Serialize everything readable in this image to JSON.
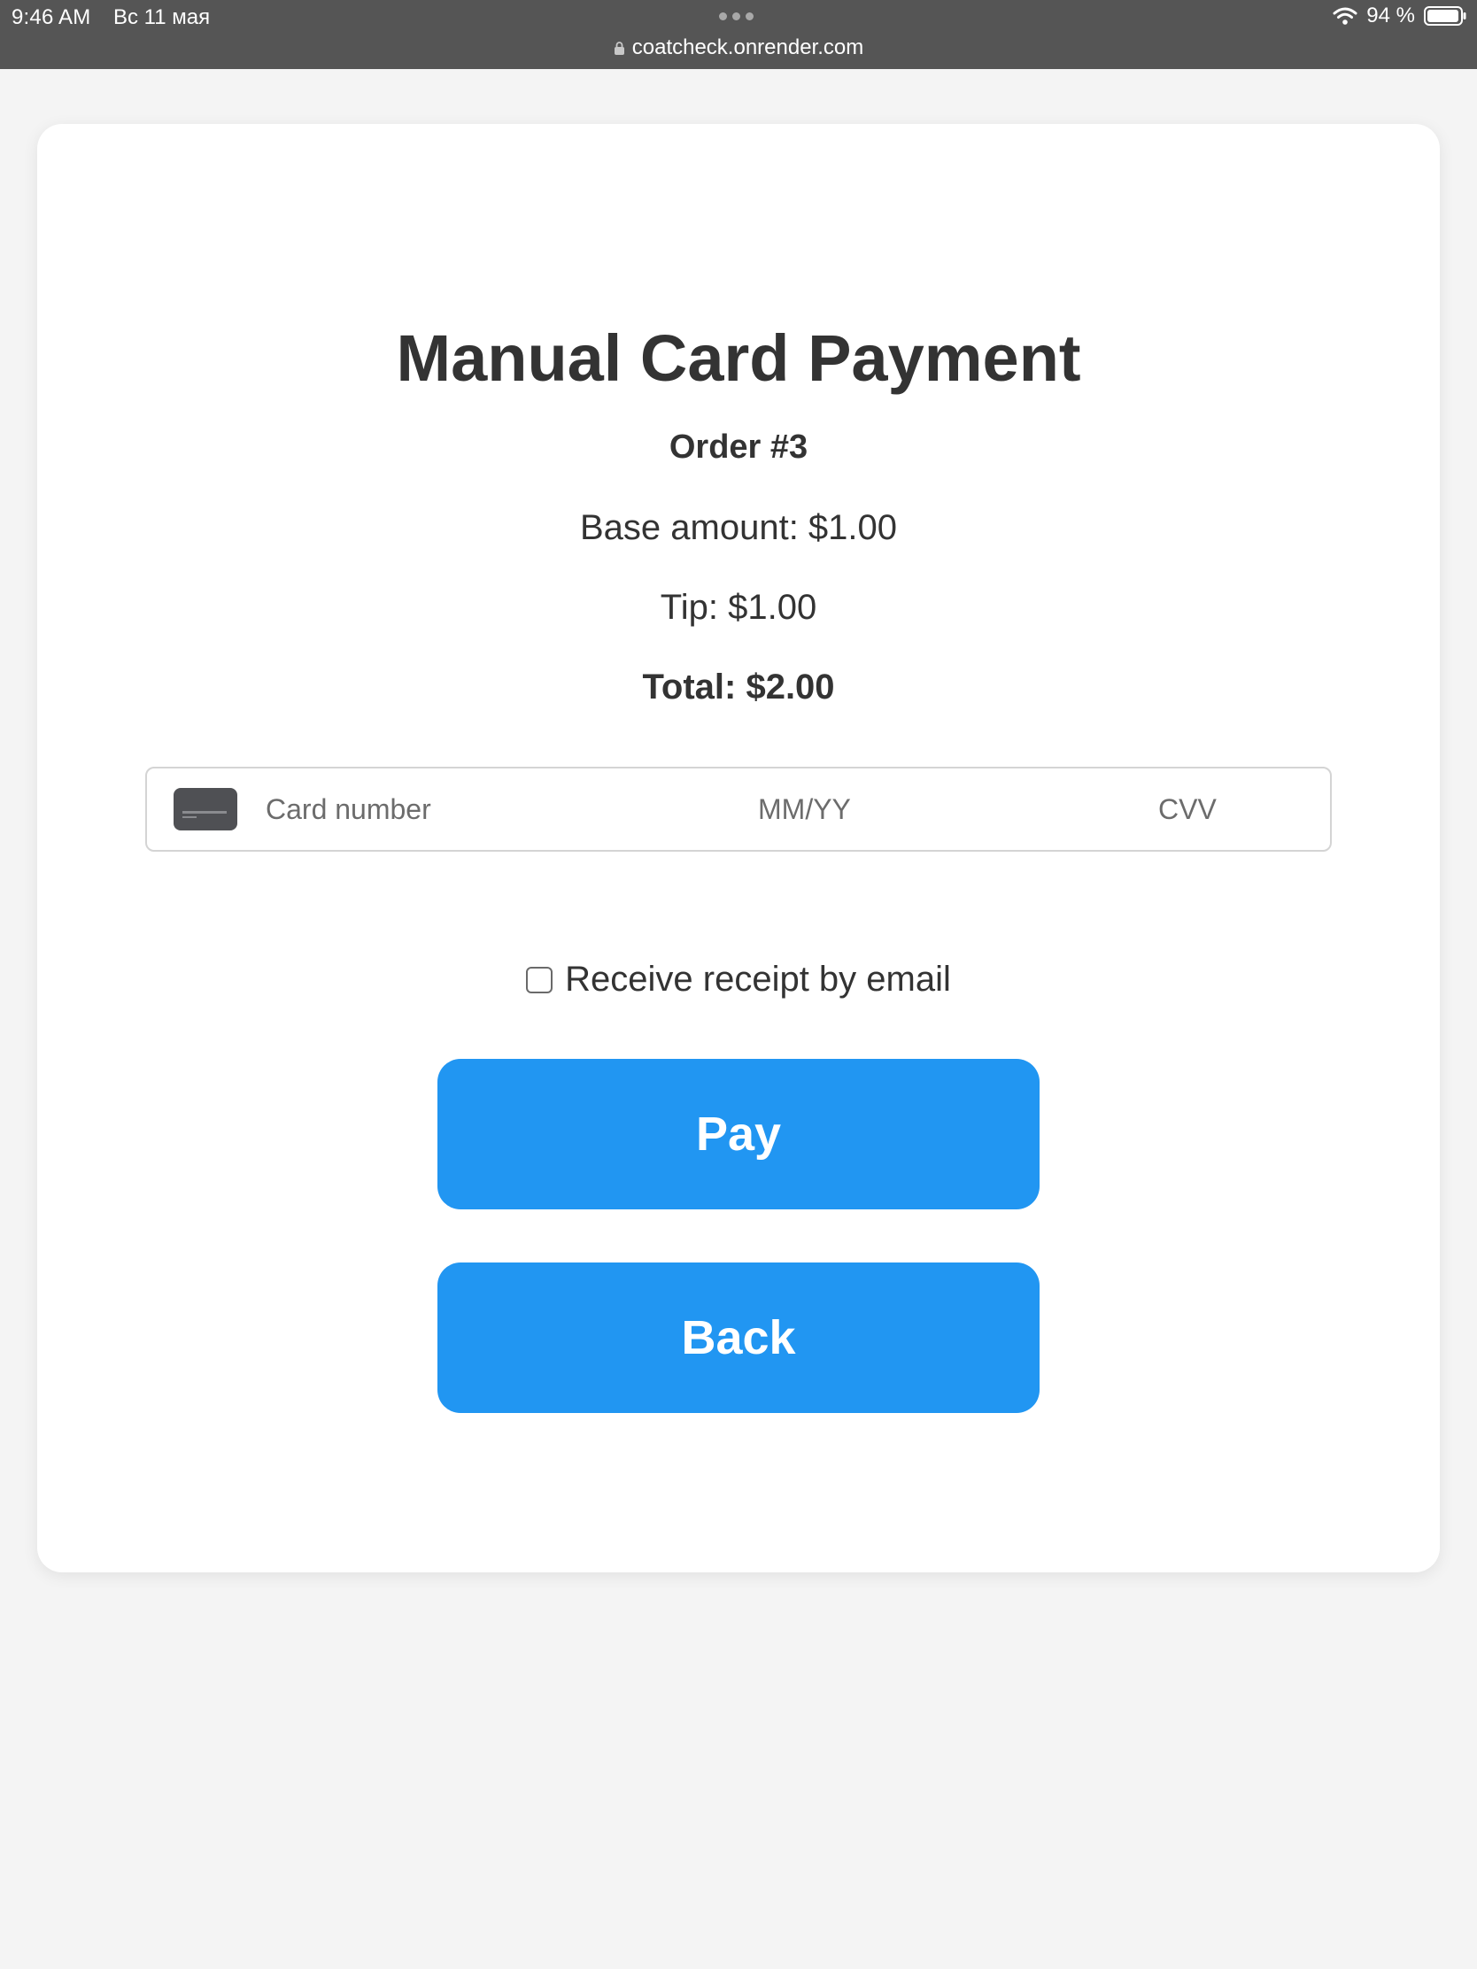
{
  "status_bar": {
    "time": "9:46 AM",
    "date": "Вс 11 мая",
    "battery": "94 %",
    "url": "coatcheck.onrender.com",
    "icons": [
      "lock-icon",
      "wifi-icon",
      "battery-icon",
      "more-dots-icon"
    ]
  },
  "page": {
    "title": "Manual Card Payment",
    "order": "Order #3",
    "base_amount": "Base amount: $1.00",
    "tip": "Tip: $1.00",
    "total": "Total: $2.00"
  },
  "card_form": {
    "brand_icon": "credit-card-icon",
    "number_placeholder": "Card number",
    "expiry_placeholder": "MM/YY",
    "cvv_placeholder": "CVV"
  },
  "receipt": {
    "label": "Receive receipt by email",
    "checked": false
  },
  "buttons": {
    "pay": "Pay",
    "back": "Back"
  },
  "colors": {
    "accent": "#2196f2",
    "status_bar": "#555555",
    "page_bg": "#f4f4f4",
    "text": "#333333"
  }
}
